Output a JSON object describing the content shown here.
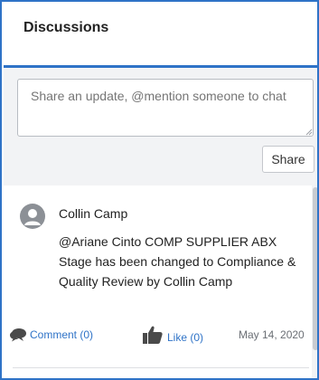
{
  "panel": {
    "title": "Discussions"
  },
  "composer": {
    "placeholder": "Share an update, @mention someone to chat",
    "share_label": "Share"
  },
  "feed": {
    "posts": [
      {
        "author": "Collin Camp",
        "avatar_icon": "user-avatar-icon",
        "body": "@Ariane Cinto COMP SUPPLIER ABX Stage has been changed to Compliance & Quality Review by Collin Camp",
        "comment_label": "Comment (0)",
        "like_label": "Like (0)",
        "date": "May 14, 2020"
      }
    ]
  },
  "colors": {
    "accent": "#2f73c7",
    "composer_bg": "#f2f3f5",
    "icon_gray": "#4a4a4a",
    "avatar_gray": "#8c9096"
  }
}
